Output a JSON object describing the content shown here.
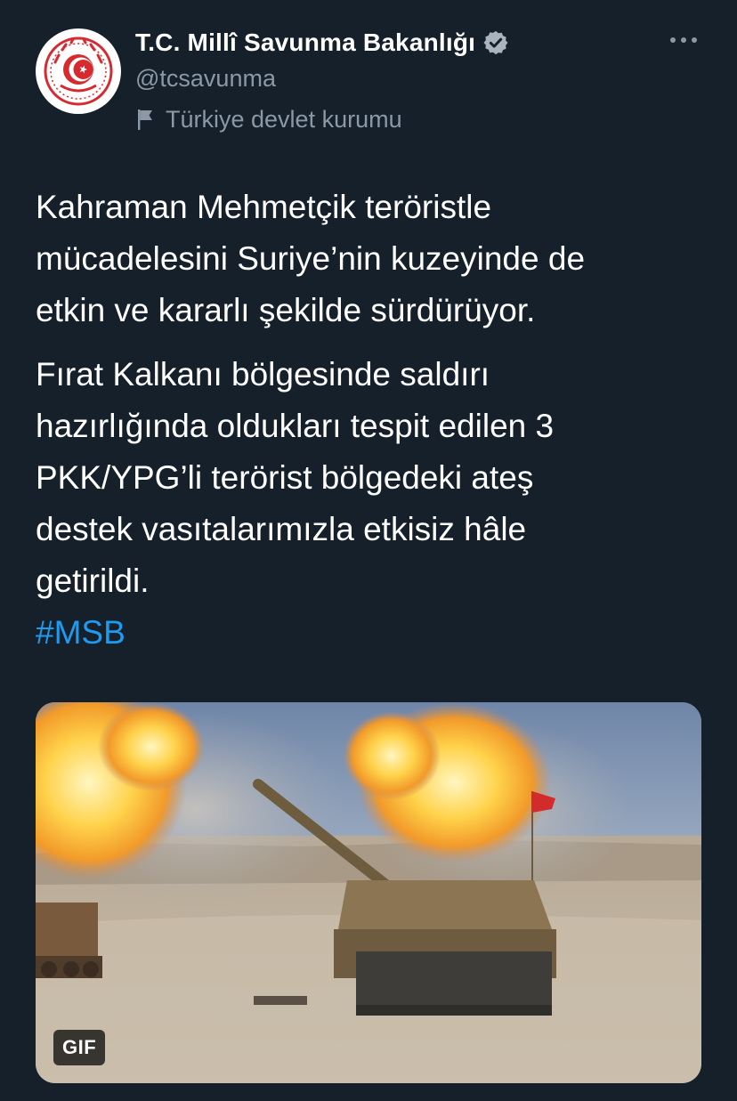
{
  "tweet": {
    "author": {
      "display_name": "T.C. Millî Savunma Bakanlığı",
      "handle": "@tcsavunma",
      "verified": true,
      "account_label": "Türkiye devlet kurumu",
      "avatar_icon": "ministry-seal-icon"
    },
    "more_icon": "more-horizontal-icon",
    "paragraph_1": "Kahraman Mehmetçik teröristle\nmücadelesini Suriye’nin kuzeyinde de\netkin ve kararlı şekilde sürdürüyor.",
    "paragraph_2": "Fırat Kalkanı bölgesinde saldırı\nhazırlığında oldukları tespit edilen 3\nPKK/YPG’li terörist bölgedeki ateş\ndestek vasıtalarımızla etkisiz hâle\ngetirildi.",
    "hashtag": "#MSB",
    "media": {
      "badge": "GIF"
    }
  },
  "colors": {
    "background": "#15202b",
    "text": "#ffffff",
    "secondary_text": "#8b98a5",
    "link": "#1d9bf0",
    "seal_red": "#d62a2f"
  }
}
